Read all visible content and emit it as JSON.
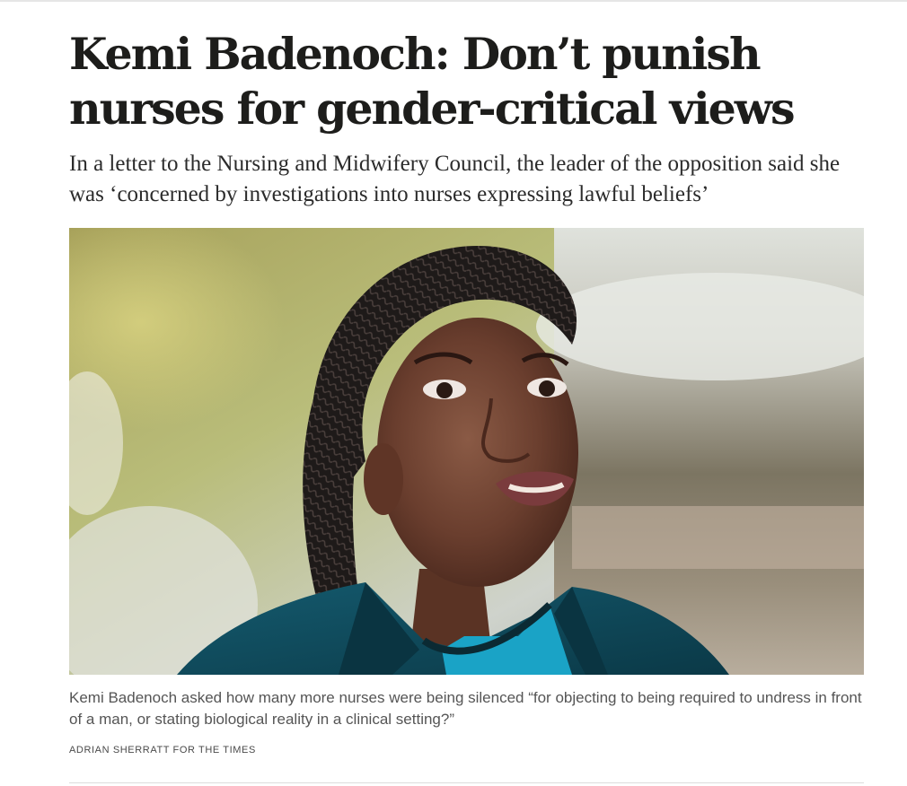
{
  "article": {
    "headline": "Kemi Badenoch: Don’t punish nurses for gender-critical views",
    "standfirst": "In a letter to the Nursing and Midwifery Council, the leader of the opposition said she was ‘concerned by investigations into nurses expressing lawful beliefs’",
    "image": {
      "caption": "Kemi Badenoch asked how many more nurses were being silenced “for objecting to being required to undress in front of a man, or stating biological reality in a clinical setting?”",
      "credit": "ADRIAN SHERRATT FOR THE TIMES"
    }
  },
  "colors": {
    "text": "#1d1d1b",
    "caption": "#555555",
    "jacket": "#0f4a5c",
    "top": "#1aa3c6"
  }
}
